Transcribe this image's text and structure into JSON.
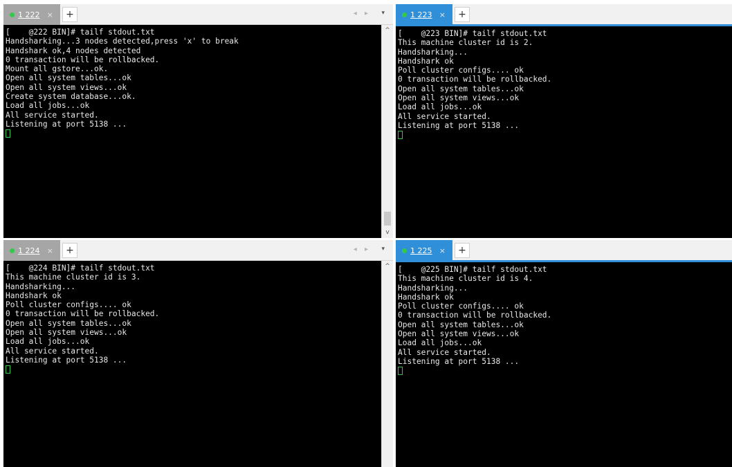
{
  "ui": {
    "close_glyph": "×",
    "add_glyph": "+",
    "nav_glyph": "◂ ▸",
    "menu_glyph": "▾",
    "scroll_up_glyph": "^",
    "scroll_down_glyph": "v"
  },
  "colors": {
    "active_tab": "#2f8fd8",
    "inactive_tab": "#a6a6a6",
    "status_dot": "#35c94a",
    "terminal_bg": "#000000",
    "terminal_fg": "#e8e8e8",
    "cursor": "#35c94a"
  },
  "panes": [
    {
      "tab": {
        "prefix": "1",
        "label": " 222",
        "status": "connected"
      },
      "active": false,
      "lines": [
        "[    @222 BIN]# tailf stdout.txt",
        "Handsharking...3 nodes detected,press 'x' to break",
        "Handshark ok,4 nodes detected",
        "0 transaction will be rollbacked.",
        "Mount all gstore...ok.",
        "Open all system tables...ok",
        "Open all system views...ok",
        "Create system database...ok.",
        "Load all jobs...ok",
        "All service started.",
        "Listening at port 5138 ..."
      ]
    },
    {
      "tab": {
        "prefix": "1",
        "label": " 223",
        "status": "connected"
      },
      "active": true,
      "lines": [
        "[    @223 BIN]# tailf stdout.txt",
        "This machine cluster id is 2.",
        "Handsharking...",
        "Handshark ok",
        "Poll cluster configs.... ok",
        "0 transaction will be rollbacked.",
        "Open all system tables...ok",
        "Open all system views...ok",
        "Load all jobs...ok",
        "All service started.",
        "Listening at port 5138 ..."
      ]
    },
    {
      "tab": {
        "prefix": "1",
        "label": " 224",
        "status": "connected"
      },
      "active": false,
      "lines": [
        "[    @224 BIN]# tailf stdout.txt",
        "This machine cluster id is 3.",
        "Handsharking...",
        "Handshark ok",
        "Poll cluster configs.... ok",
        "0 transaction will be rollbacked.",
        "Open all system tables...ok",
        "Open all system views...ok",
        "Load all jobs...ok",
        "All service started.",
        "Listening at port 5138 ..."
      ]
    },
    {
      "tab": {
        "prefix": "1",
        "label": " 225",
        "status": "connected"
      },
      "active": true,
      "lines": [
        "[    @225 BIN]# tailf stdout.txt",
        "This machine cluster id is 4.",
        "Handsharking...",
        "Handshark ok",
        "Poll cluster configs.... ok",
        "0 transaction will be rollbacked.",
        "Open all system tables...ok",
        "Open all system views...ok",
        "Load all jobs...ok",
        "All service started.",
        "Listening at port 5138 ..."
      ]
    }
  ]
}
